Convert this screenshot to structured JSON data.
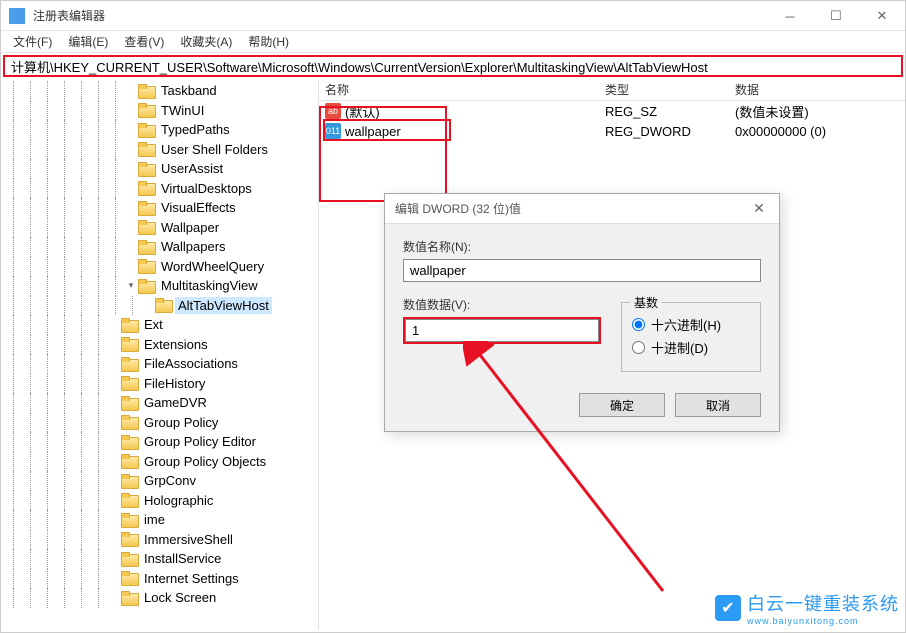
{
  "window": {
    "title": "注册表编辑器"
  },
  "menu": {
    "file": "文件(F)",
    "edit": "编辑(E)",
    "view": "查看(V)",
    "favorites": "收藏夹(A)",
    "help": "帮助(H)"
  },
  "address": "计算机\\HKEY_CURRENT_USER\\Software\\Microsoft\\Windows\\CurrentVersion\\Explorer\\MultitaskingView\\AltTabViewHost",
  "tree": {
    "items": [
      {
        "depth": 7,
        "exp": "",
        "label": "Taskband"
      },
      {
        "depth": 7,
        "exp": "",
        "label": "TWinUI"
      },
      {
        "depth": 7,
        "exp": "",
        "label": "TypedPaths"
      },
      {
        "depth": 7,
        "exp": "",
        "label": "User Shell Folders"
      },
      {
        "depth": 7,
        "exp": "",
        "label": "UserAssist"
      },
      {
        "depth": 7,
        "exp": "",
        "label": "VirtualDesktops"
      },
      {
        "depth": 7,
        "exp": "",
        "label": "VisualEffects"
      },
      {
        "depth": 7,
        "exp": "",
        "label": "Wallpaper"
      },
      {
        "depth": 7,
        "exp": "",
        "label": "Wallpapers"
      },
      {
        "depth": 7,
        "exp": "",
        "label": "WordWheelQuery"
      },
      {
        "depth": 7,
        "exp": "v",
        "label": "MultitaskingView"
      },
      {
        "depth": 8,
        "exp": "",
        "label": "AltTabViewHost",
        "selected": true
      },
      {
        "depth": 6,
        "exp": "",
        "label": "Ext"
      },
      {
        "depth": 6,
        "exp": "",
        "label": "Extensions"
      },
      {
        "depth": 6,
        "exp": "",
        "label": "FileAssociations"
      },
      {
        "depth": 6,
        "exp": "",
        "label": "FileHistory"
      },
      {
        "depth": 6,
        "exp": "",
        "label": "GameDVR"
      },
      {
        "depth": 6,
        "exp": "",
        "label": "Group Policy"
      },
      {
        "depth": 6,
        "exp": "",
        "label": "Group Policy Editor"
      },
      {
        "depth": 6,
        "exp": "",
        "label": "Group Policy Objects"
      },
      {
        "depth": 6,
        "exp": "",
        "label": "GrpConv"
      },
      {
        "depth": 6,
        "exp": "",
        "label": "Holographic"
      },
      {
        "depth": 6,
        "exp": "",
        "label": "ime"
      },
      {
        "depth": 6,
        "exp": "",
        "label": "ImmersiveShell"
      },
      {
        "depth": 6,
        "exp": "",
        "label": "InstallService"
      },
      {
        "depth": 6,
        "exp": "",
        "label": "Internet Settings"
      },
      {
        "depth": 6,
        "exp": "",
        "label": "Lock Screen"
      }
    ]
  },
  "columns": {
    "name": "名称",
    "type": "类型",
    "data": "数据"
  },
  "values": [
    {
      "icon": "str",
      "name": "(默认)",
      "type": "REG_SZ",
      "data": "(数值未设置)"
    },
    {
      "icon": "dw",
      "name": "wallpaper",
      "type": "REG_DWORD",
      "data": "0x00000000 (0)"
    }
  ],
  "dialog": {
    "title": "编辑 DWORD (32 位)值",
    "name_label": "数值名称(N):",
    "name_value": "wallpaper",
    "data_label": "数值数据(V):",
    "data_value": "1",
    "radix_label": "基数",
    "radix_hex": "十六进制(H)",
    "radix_dec": "十进制(D)",
    "ok": "确定",
    "cancel": "取消"
  },
  "watermark": {
    "text": "白云一键重装系统",
    "url": "www.baiyunxitong.com"
  }
}
